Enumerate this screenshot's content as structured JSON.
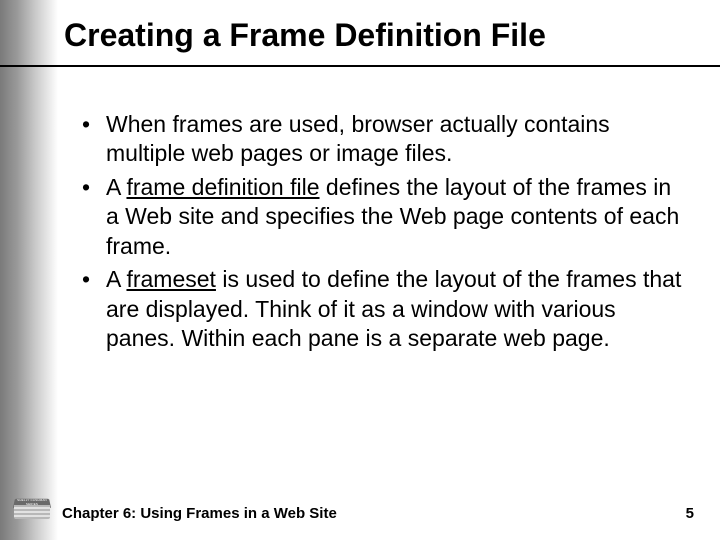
{
  "slide": {
    "title": "Creating a Frame Definition File",
    "bullets": [
      {
        "segments": [
          {
            "text": "When frames are used, browser actually contains multiple web pages or image files.",
            "underline": false
          }
        ]
      },
      {
        "segments": [
          {
            "text": "A ",
            "underline": false
          },
          {
            "text": "frame definition file",
            "underline": true
          },
          {
            "text": " defines the layout of the frames in a Web site and specifies the Web page contents of each frame.",
            "underline": false
          }
        ]
      },
      {
        "segments": [
          {
            "text": "A ",
            "underline": false
          },
          {
            "text": "frameset",
            "underline": true
          },
          {
            "text": " is used to define the layout of the frames that are displayed.  Think of it as a window with various panes.  Within each pane is a separate web page.",
            "underline": false
          }
        ]
      }
    ]
  },
  "footer": {
    "chapter_label": "Chapter 6: Using Frames in a Web Site",
    "page_number": "5",
    "logo_text": "SHELLY CASHMAN SERIES"
  }
}
